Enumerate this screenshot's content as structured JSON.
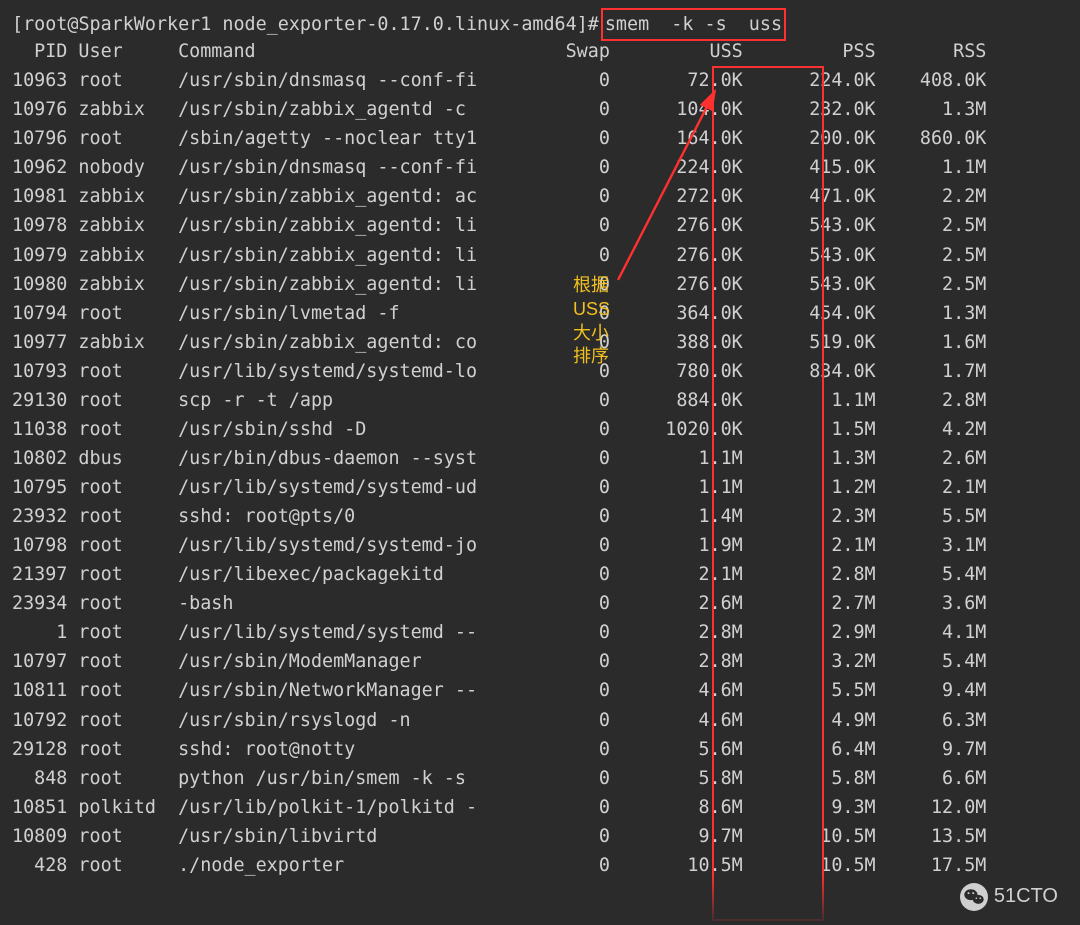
{
  "prompt": {
    "left": "[",
    "user_host": "root@SparkWorker1",
    "sep": " ",
    "cwd": "node_exporter-0.17.0.linux-amd64",
    "right": "]",
    "symbol": "#",
    "command": "smem  -k -s  uss"
  },
  "columns": [
    "PID",
    "User",
    "Command",
    "Swap",
    "USS",
    "PSS",
    "RSS"
  ],
  "rows": [
    {
      "pid": "10963",
      "user": "root",
      "cmd": "/usr/sbin/dnsmasq --conf-fi",
      "swap": "0",
      "uss": "72.0K",
      "pss": "224.0K",
      "rss": "408.0K"
    },
    {
      "pid": "10976",
      "user": "zabbix",
      "cmd": "/usr/sbin/zabbix_agentd -c",
      "swap": "0",
      "uss": "104.0K",
      "pss": "232.0K",
      "rss": "1.3M"
    },
    {
      "pid": "10796",
      "user": "root",
      "cmd": "/sbin/agetty --noclear tty1",
      "swap": "0",
      "uss": "164.0K",
      "pss": "200.0K",
      "rss": "860.0K"
    },
    {
      "pid": "10962",
      "user": "nobody",
      "cmd": "/usr/sbin/dnsmasq --conf-fi",
      "swap": "0",
      "uss": "224.0K",
      "pss": "415.0K",
      "rss": "1.1M"
    },
    {
      "pid": "10981",
      "user": "zabbix",
      "cmd": "/usr/sbin/zabbix_agentd: ac",
      "swap": "0",
      "uss": "272.0K",
      "pss": "471.0K",
      "rss": "2.2M"
    },
    {
      "pid": "10978",
      "user": "zabbix",
      "cmd": "/usr/sbin/zabbix_agentd: li",
      "swap": "0",
      "uss": "276.0K",
      "pss": "543.0K",
      "rss": "2.5M"
    },
    {
      "pid": "10979",
      "user": "zabbix",
      "cmd": "/usr/sbin/zabbix_agentd: li",
      "swap": "0",
      "uss": "276.0K",
      "pss": "543.0K",
      "rss": "2.5M"
    },
    {
      "pid": "10980",
      "user": "zabbix",
      "cmd": "/usr/sbin/zabbix_agentd: li",
      "swap": "0",
      "uss": "276.0K",
      "pss": "543.0K",
      "rss": "2.5M"
    },
    {
      "pid": "10794",
      "user": "root",
      "cmd": "/usr/sbin/lvmetad -f",
      "swap": "0",
      "uss": "364.0K",
      "pss": "454.0K",
      "rss": "1.3M"
    },
    {
      "pid": "10977",
      "user": "zabbix",
      "cmd": "/usr/sbin/zabbix_agentd: co",
      "swap": "0",
      "uss": "388.0K",
      "pss": "519.0K",
      "rss": "1.6M"
    },
    {
      "pid": "10793",
      "user": "root",
      "cmd": "/usr/lib/systemd/systemd-lo",
      "swap": "0",
      "uss": "780.0K",
      "pss": "834.0K",
      "rss": "1.7M"
    },
    {
      "pid": "29130",
      "user": "root",
      "cmd": "scp -r -t /app",
      "swap": "0",
      "uss": "884.0K",
      "pss": "1.1M",
      "rss": "2.8M"
    },
    {
      "pid": "11038",
      "user": "root",
      "cmd": "/usr/sbin/sshd -D",
      "swap": "0",
      "uss": "1020.0K",
      "pss": "1.5M",
      "rss": "4.2M"
    },
    {
      "pid": "10802",
      "user": "dbus",
      "cmd": "/usr/bin/dbus-daemon --syst",
      "swap": "0",
      "uss": "1.1M",
      "pss": "1.3M",
      "rss": "2.6M"
    },
    {
      "pid": "10795",
      "user": "root",
      "cmd": "/usr/lib/systemd/systemd-ud",
      "swap": "0",
      "uss": "1.1M",
      "pss": "1.2M",
      "rss": "2.1M"
    },
    {
      "pid": "23932",
      "user": "root",
      "cmd": "sshd: root@pts/0",
      "swap": "0",
      "uss": "1.4M",
      "pss": "2.3M",
      "rss": "5.5M"
    },
    {
      "pid": "10798",
      "user": "root",
      "cmd": "/usr/lib/systemd/systemd-jo",
      "swap": "0",
      "uss": "1.9M",
      "pss": "2.1M",
      "rss": "3.1M"
    },
    {
      "pid": "21397",
      "user": "root",
      "cmd": "/usr/libexec/packagekitd",
      "swap": "0",
      "uss": "2.1M",
      "pss": "2.8M",
      "rss": "5.4M"
    },
    {
      "pid": "23934",
      "user": "root",
      "cmd": "-bash",
      "swap": "0",
      "uss": "2.6M",
      "pss": "2.7M",
      "rss": "3.6M"
    },
    {
      "pid": "1",
      "user": "root",
      "cmd": "/usr/lib/systemd/systemd --",
      "swap": "0",
      "uss": "2.8M",
      "pss": "2.9M",
      "rss": "4.1M"
    },
    {
      "pid": "10797",
      "user": "root",
      "cmd": "/usr/sbin/ModemManager",
      "swap": "0",
      "uss": "2.8M",
      "pss": "3.2M",
      "rss": "5.4M"
    },
    {
      "pid": "10811",
      "user": "root",
      "cmd": "/usr/sbin/NetworkManager --",
      "swap": "0",
      "uss": "4.6M",
      "pss": "5.5M",
      "rss": "9.4M"
    },
    {
      "pid": "10792",
      "user": "root",
      "cmd": "/usr/sbin/rsyslogd -n",
      "swap": "0",
      "uss": "4.6M",
      "pss": "4.9M",
      "rss": "6.3M"
    },
    {
      "pid": "29128",
      "user": "root",
      "cmd": "sshd: root@notty",
      "swap": "0",
      "uss": "5.6M",
      "pss": "6.4M",
      "rss": "9.7M"
    },
    {
      "pid": "848",
      "user": "root",
      "cmd": "python /usr/bin/smem -k -s",
      "swap": "0",
      "uss": "5.8M",
      "pss": "5.8M",
      "rss": "6.6M"
    },
    {
      "pid": "10851",
      "user": "polkitd",
      "cmd": "/usr/lib/polkit-1/polkitd -",
      "swap": "0",
      "uss": "8.6M",
      "pss": "9.3M",
      "rss": "12.0M"
    },
    {
      "pid": "10809",
      "user": "root",
      "cmd": "/usr/sbin/libvirtd",
      "swap": "0",
      "uss": "9.7M",
      "pss": "10.5M",
      "rss": "13.5M"
    },
    {
      "pid": "428",
      "user": "root",
      "cmd": "./node_exporter",
      "swap": "0",
      "uss": "10.5M",
      "pss": "10.5M",
      "rss": "17.5M"
    }
  ],
  "annotation": {
    "note": "根据\nUSS\n大小\n排序"
  },
  "footer": {
    "brand": "51CTO"
  },
  "col_widths": {
    "pid": 5,
    "user": 8,
    "cmd": 32,
    "swap": 7,
    "uss": 12,
    "pss": 12,
    "rss": 10
  }
}
